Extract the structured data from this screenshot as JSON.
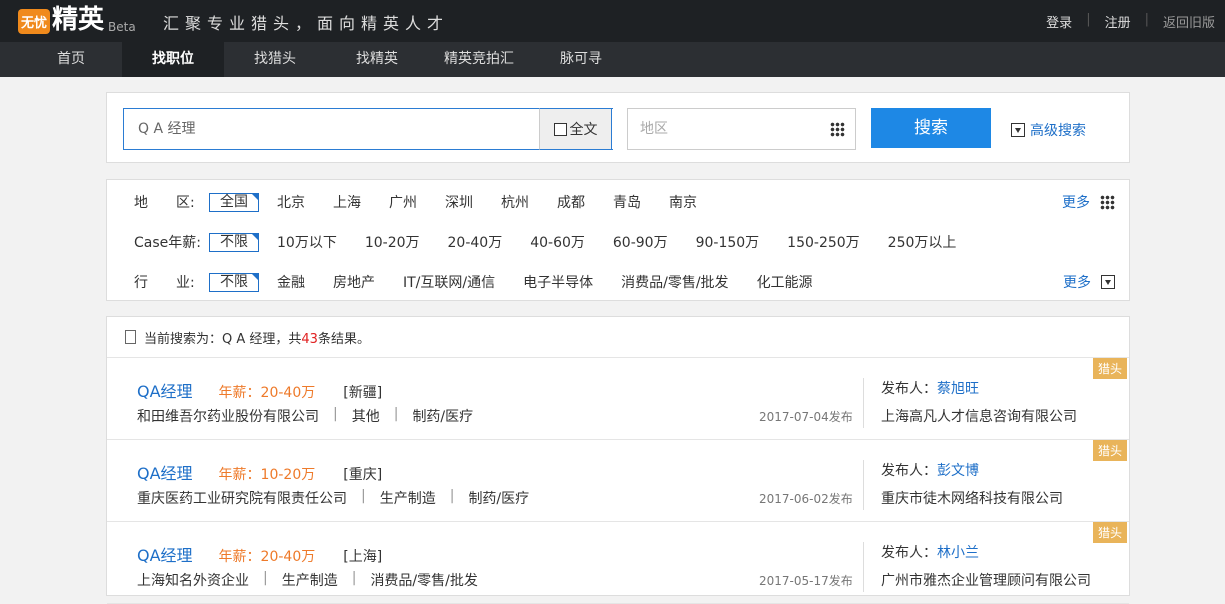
{
  "header": {
    "logo_badge": "无忧",
    "logo_name": "精英",
    "logo_beta": "Beta",
    "slogan": "汇聚专业猎头，面向精英人才",
    "login": "登录",
    "register": "注册",
    "old_version": "返回旧版",
    "sep": "|"
  },
  "nav": [
    "首页",
    "找职位",
    "找猎头",
    "找精英",
    "精英竞拍汇",
    "脉可寻"
  ],
  "search": {
    "keyword": "Q A 经理",
    "fulltext": "全文",
    "area_placeholder": "地区",
    "button": "搜索",
    "advanced": "高级搜索"
  },
  "filters": {
    "region": {
      "label": "地　　区:",
      "selected": "全国",
      "options": [
        "北京",
        "上海",
        "广州",
        "深圳",
        "杭州",
        "成都",
        "青岛",
        "南京"
      ],
      "more": "更多"
    },
    "salary": {
      "label": "Case年薪:",
      "selected": "不限",
      "options": [
        "10万以下",
        "10-20万",
        "20-40万",
        "40-60万",
        "60-90万",
        "90-150万",
        "150-250万",
        "250万以上"
      ]
    },
    "industry": {
      "label": "行　　业:",
      "selected": "不限",
      "options": [
        "金融",
        "房地产",
        "IT/互联网/通信",
        "电子半导体",
        "消费品/零售/批发",
        "化工能源"
      ],
      "more": "更多"
    }
  },
  "results": {
    "prefix": "当前搜索为：Q A 经理，共",
    "count": "43",
    "suffix": "条结果。",
    "items": [
      {
        "title": "QA经理",
        "salary": "年薪：20-40万",
        "city": "[新疆]",
        "company": "和田维吾尔药业股份有限公司",
        "func": "其他",
        "industry": "制药/医疗",
        "date": "2017-07-04发布",
        "publisher_label": "发布人：",
        "publisher": "蔡旭旺",
        "agency": "上海高凡人才信息咨询有限公司",
        "tag": "猎头"
      },
      {
        "title": "QA经理",
        "salary": "年薪：10-20万",
        "city": "[重庆]",
        "company": "重庆医药工业研究院有限责任公司",
        "func": "生产制造",
        "industry": "制药/医疗",
        "date": "2017-06-02发布",
        "publisher_label": "发布人：",
        "publisher": "彭文博",
        "agency": "重庆市徒木网络科技有限公司",
        "tag": "猎头"
      },
      {
        "title": "QA经理",
        "salary": "年薪：20-40万",
        "city": "[上海]",
        "company": "上海知名外资企业",
        "func": "生产制造",
        "industry": "消费品/零售/批发",
        "date": "2017-05-17发布",
        "publisher_label": "发布人：",
        "publisher": "林小兰",
        "agency": "广州市雅杰企业管理顾问有限公司",
        "tag": "猎头"
      }
    ]
  }
}
